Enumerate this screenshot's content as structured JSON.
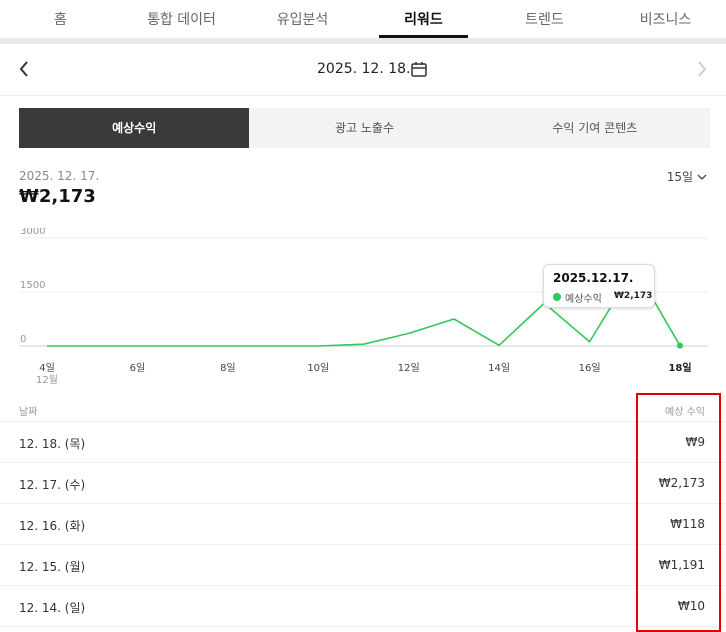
{
  "nav": {
    "tabs": [
      {
        "label": "홈",
        "active": false
      },
      {
        "label": "통합 데이터",
        "active": false
      },
      {
        "label": "유입분석",
        "active": false
      },
      {
        "label": "리워드",
        "active": true
      },
      {
        "label": "트렌드",
        "active": false
      },
      {
        "label": "비즈니스",
        "active": false
      }
    ]
  },
  "date_nav": {
    "date": "2025. 12. 18.",
    "icon": "calendar-icon"
  },
  "segments": [
    {
      "label": "예상수익",
      "active": true
    },
    {
      "label": "광고 노출수",
      "active": false
    },
    {
      "label": "수익 기여 콘텐츠",
      "active": false
    }
  ],
  "summary": {
    "date": "2025. 12. 17.",
    "amount": "₩2,173"
  },
  "range": {
    "label": "15일"
  },
  "tooltip": {
    "date": "2025.12.17.",
    "series": "예상수익",
    "value": "₩2,173"
  },
  "colors": {
    "line": "#34c759",
    "active_segment": "#3a3a3a",
    "highlight": "#e00000"
  },
  "chart_data": {
    "type": "line",
    "x_tick_labels": [
      "4일",
      "6일",
      "8일",
      "10일",
      "12일",
      "14일",
      "16일",
      "18일"
    ],
    "x_sublabel": "12월",
    "y_tick_labels": [
      "3000",
      "1500",
      "0"
    ],
    "ylim": [
      0,
      3000
    ],
    "grid": true,
    "series": [
      {
        "name": "예상수익",
        "x": [
          4,
          5,
          6,
          7,
          8,
          9,
          10,
          11,
          12,
          13,
          14,
          15,
          16,
          17,
          18
        ],
        "values": [
          0,
          0,
          0,
          0,
          0,
          0,
          0,
          50,
          350,
          750,
          20,
          1191,
          118,
          2173,
          9
        ]
      }
    ]
  },
  "table": {
    "header_date": "날짜",
    "header_value": "예상 수익",
    "rows": [
      {
        "date": "12. 18. (목)",
        "value": "₩9"
      },
      {
        "date": "12. 17. (수)",
        "value": "₩2,173"
      },
      {
        "date": "12. 16. (화)",
        "value": "₩118"
      },
      {
        "date": "12. 15. (월)",
        "value": "₩1,191"
      },
      {
        "date": "12. 14. (일)",
        "value": "₩10"
      }
    ]
  }
}
